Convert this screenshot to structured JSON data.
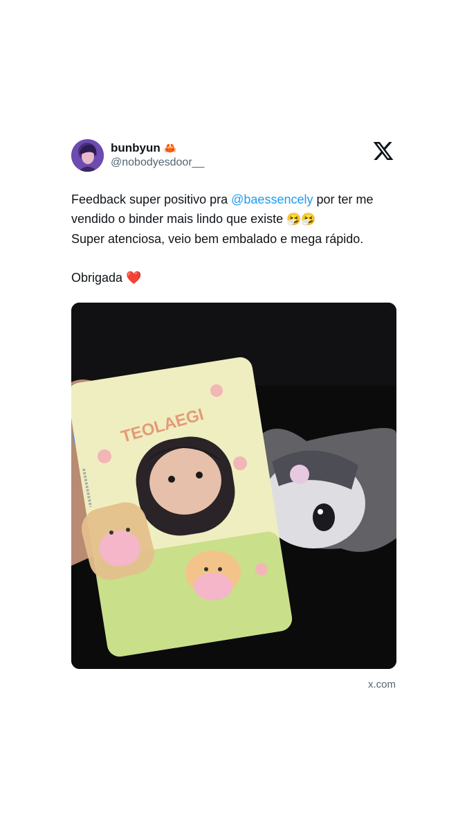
{
  "tweet": {
    "display_name": "bunbyun",
    "name_emoji": "🦀",
    "handle": "@nobodyesdoor__",
    "lines": {
      "l1_pre": "Feedback super positivo pra ",
      "mention": "@baessencely",
      "l1_post": " por ter me",
      "l2": "vendido o binder mais lindo que existe ",
      "l2_emoji": "🤧🤧",
      "l3": "Super atenciosa, veio bem embalado e mega rápido.",
      "l4": "Obrigada ",
      "heart": "❤️"
    },
    "photo_text": "TEOLAEGI",
    "source": "x.com"
  },
  "icons": {
    "platform": "x-logo-icon",
    "name_badge": "crab-icon"
  },
  "colors": {
    "link": "#1d9bf0",
    "secondary_text": "#536471",
    "primary_text": "#0f1419"
  }
}
